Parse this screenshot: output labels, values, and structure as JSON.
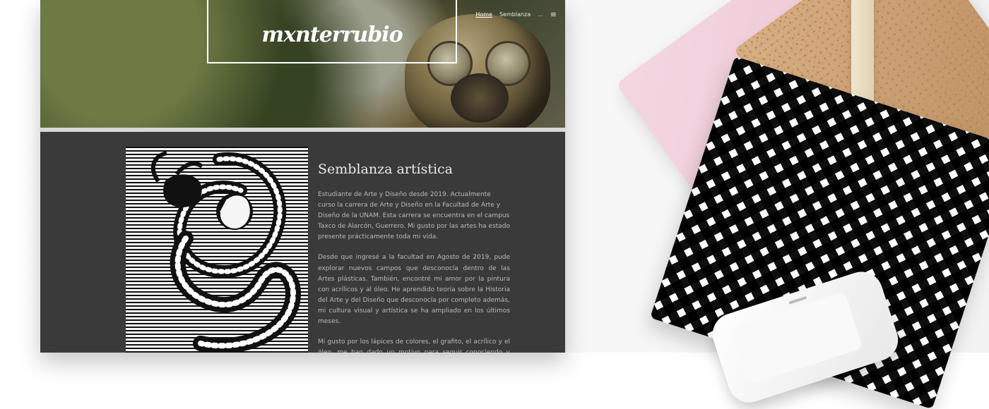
{
  "site": {
    "logo": "mxnterrubio",
    "nav": [
      "Home",
      "Semblanza",
      "..."
    ],
    "menu_icon": "hamburger-icon"
  },
  "main": {
    "title": "Semblanza artística",
    "paragraphs": [
      "Estudiante de Arte y Diseño desde 2019. Actualmente curso la carrera de Arte y Diseño en la Facultad de Arte y Diseño de la UNAM. Esta carrera se encuentra en el campus Taxco de Alarcón, Guerrero. Mi gusto por las artes ha estado presente prácticamente toda mi vida.",
      "Desde que ingresé a la facultad en Agosto de 2019, pude explorar nuevos campos que desconocía dentro de las Artes plásticas. También, encontré mi amor por la pintura con acrílicos y al óleo. He aprendido teoría sobre la Historia del Arte y del Diseño que desconocía por completo además, mi cultura visual y artística se ha ampliado en los últimos meses.",
      "Mi gusto por los lápices de colores, el grafito, el acrílico y el óleo, me han dado un motivo para seguir conociendo y experimentando técnicas con dichos materiales."
    ]
  }
}
